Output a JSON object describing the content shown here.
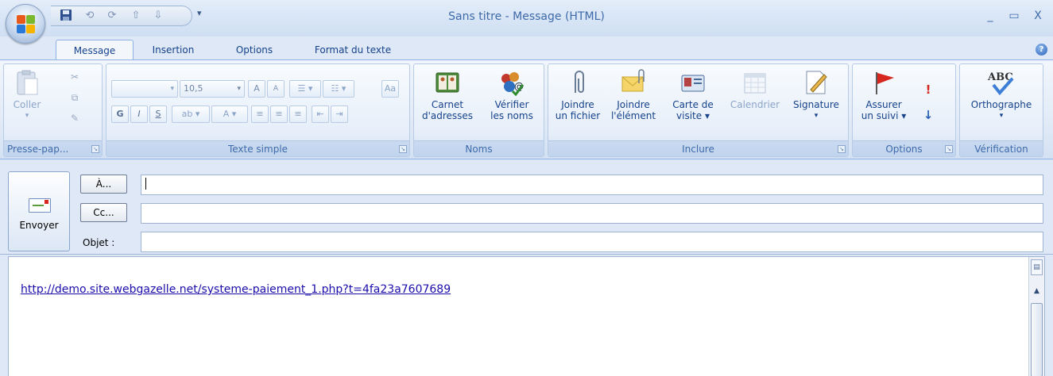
{
  "window": {
    "title": "Sans titre - Message (HTML)",
    "minimize": "_",
    "maximize": "▭",
    "close": "X"
  },
  "qat": {
    "customize": "▾"
  },
  "tabs": [
    {
      "label": "Message",
      "active": true
    },
    {
      "label": "Insertion",
      "active": false
    },
    {
      "label": "Options",
      "active": false
    },
    {
      "label": "Format du texte",
      "active": false
    }
  ],
  "help": "?",
  "ribbon": {
    "clipboard": {
      "label": "Presse-pap...",
      "paste": "Coller",
      "paste_arrow": "▾"
    },
    "basic_text": {
      "label": "Texte simple",
      "font_size": "10,5",
      "bold": "G",
      "italic": "I",
      "underline": "S"
    },
    "names": {
      "label": "Noms",
      "address_book_line1": "Carnet",
      "address_book_line2": "d'adresses",
      "check_names_line1": "Vérifier",
      "check_names_line2": "les noms"
    },
    "include": {
      "label": "Inclure",
      "attach_file_line1": "Joindre",
      "attach_file_line2": "un fichier",
      "attach_item_line1": "Joindre",
      "attach_item_line2": "l'élément",
      "business_card_line1": "Carte de",
      "business_card_line2": "visite ▾",
      "calendar": "Calendrier",
      "signature": "Signature",
      "signature_arrow": "▾"
    },
    "options": {
      "label": "Options",
      "follow_up_line1": "Assurer",
      "follow_up_line2": "un suivi ▾",
      "high_importance": "!",
      "low_importance": "↓"
    },
    "proofing": {
      "label": "Vérification",
      "spelling": "Orthographe",
      "spelling_arrow": "▾",
      "abc": "ABC"
    }
  },
  "header": {
    "send": "Envoyer",
    "to_button": "À...",
    "cc_button": "Cc...",
    "subject_label": "Objet :",
    "to_value": "",
    "cc_value": "",
    "subject_value": ""
  },
  "body": {
    "link": "http://demo.site.webgazelle.net/systeme-paiement_1.php?t=4fa23a7607689"
  },
  "colors": {
    "accent": "#15428b",
    "ribbon_bg": "#dfe9f6",
    "link": "#1a0dab"
  }
}
